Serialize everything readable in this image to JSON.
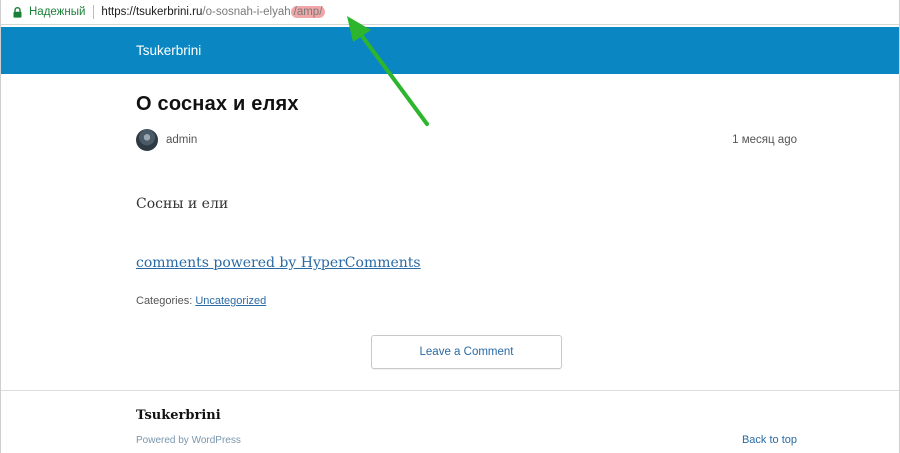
{
  "address_bar": {
    "secure_label": "Надежный",
    "url_host": "https://tsukerbrini.ru",
    "url_path": "/o-sosnah-i-elyah",
    "url_highlight": "/amp/"
  },
  "header": {
    "site_title": "Tsukerbrini"
  },
  "post": {
    "title": "О соснах и елях",
    "author": "admin",
    "date": "1 месяц ago",
    "body": "Сосны и ели",
    "comments_link": "comments powered by HyperComments",
    "categories_label": "Categories: ",
    "category": "Uncategorized",
    "comment_button": "Leave a Comment"
  },
  "footer": {
    "title": "Tsukerbrini",
    "powered_by": "Powered by WordPress",
    "back_to_top": "Back to top"
  },
  "colors": {
    "header_bg": "#0a87c2",
    "link": "#2a6aa5",
    "secure": "#1a7f37",
    "annotation_arrow": "#2db52d"
  },
  "icons": {
    "lock": "lock-icon",
    "avatar": "avatar",
    "annotation": "arrow-annotation-icon"
  }
}
